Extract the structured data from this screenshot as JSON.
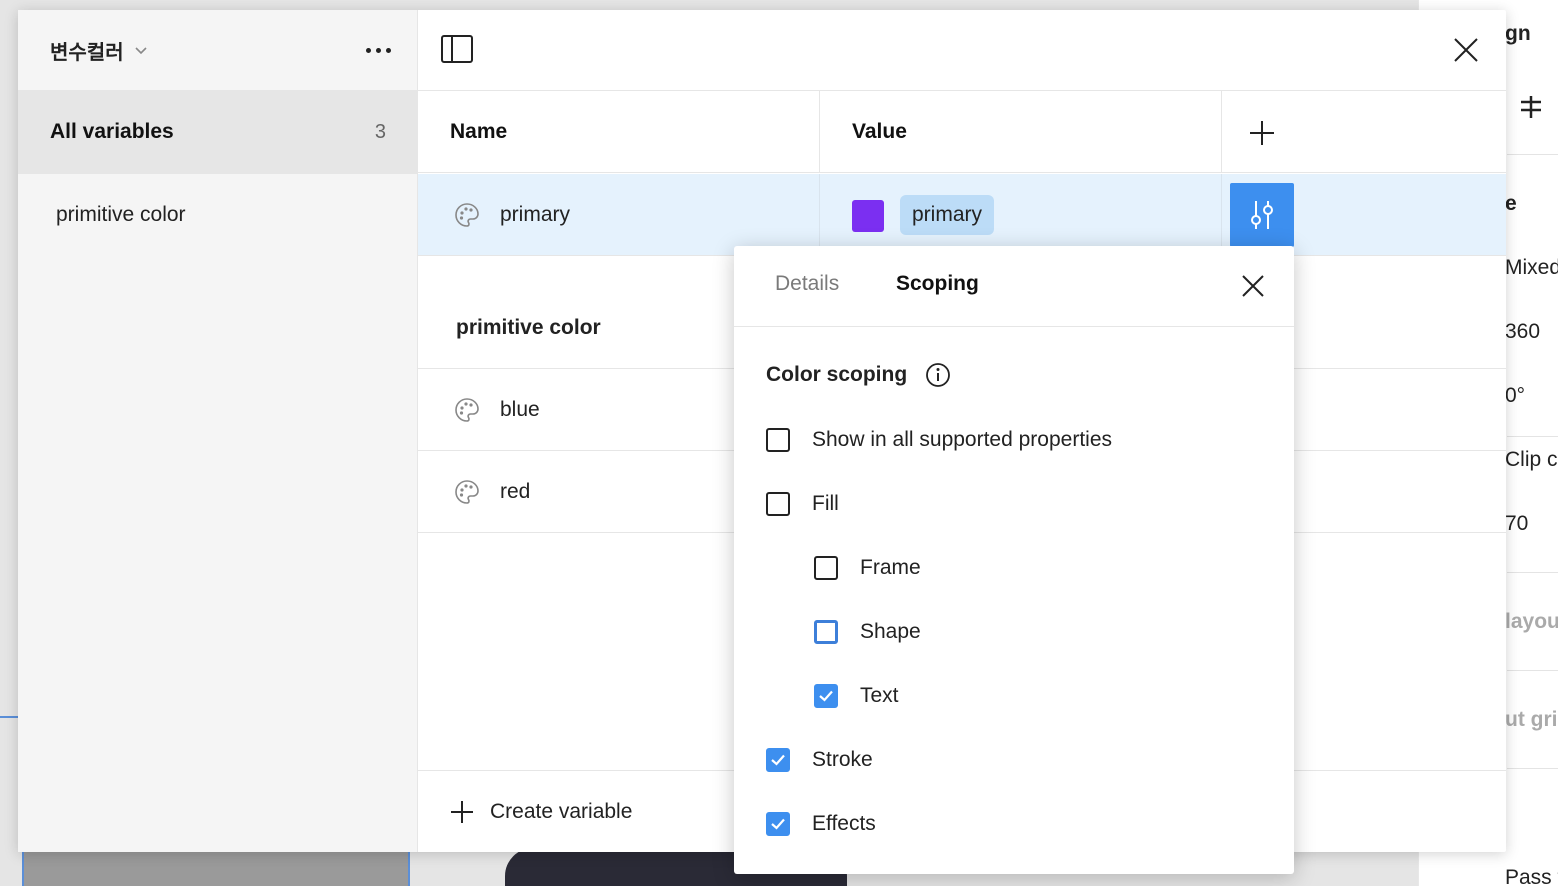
{
  "background": {
    "right_fragments": [
      "gn",
      "e",
      "Mixed",
      "360",
      "0°",
      "Clip c",
      "70",
      "layou",
      "ut grid",
      "Pass t"
    ]
  },
  "sidebar": {
    "collection_title": "변수컬러",
    "items": [
      {
        "label": "All variables",
        "count": "3"
      },
      {
        "label": "primitive color"
      }
    ]
  },
  "table": {
    "headers": {
      "name": "Name",
      "value": "Value"
    },
    "rows": [
      {
        "name": "primary",
        "value_label": "primary",
        "swatch_color": "#7B2FF1"
      },
      {
        "name": "blue"
      },
      {
        "name": "red"
      }
    ],
    "group_title": "primitive color",
    "create_label": "Create variable"
  },
  "popover": {
    "tabs": {
      "details": "Details",
      "scoping": "Scoping"
    },
    "section_title": "Color scoping",
    "options": [
      {
        "label": "Show in all supported properties",
        "checked": false
      },
      {
        "label": "Fill",
        "checked": false
      },
      {
        "label": "Frame",
        "checked": false
      },
      {
        "label": "Shape",
        "checked": false
      },
      {
        "label": "Text",
        "checked": true
      },
      {
        "label": "Stroke",
        "checked": true
      },
      {
        "label": "Effects",
        "checked": true
      }
    ]
  },
  "colors": {
    "accent": "#3D8FEF",
    "selected_row": "#E5F2FD",
    "chip": "#BCDCF7"
  }
}
